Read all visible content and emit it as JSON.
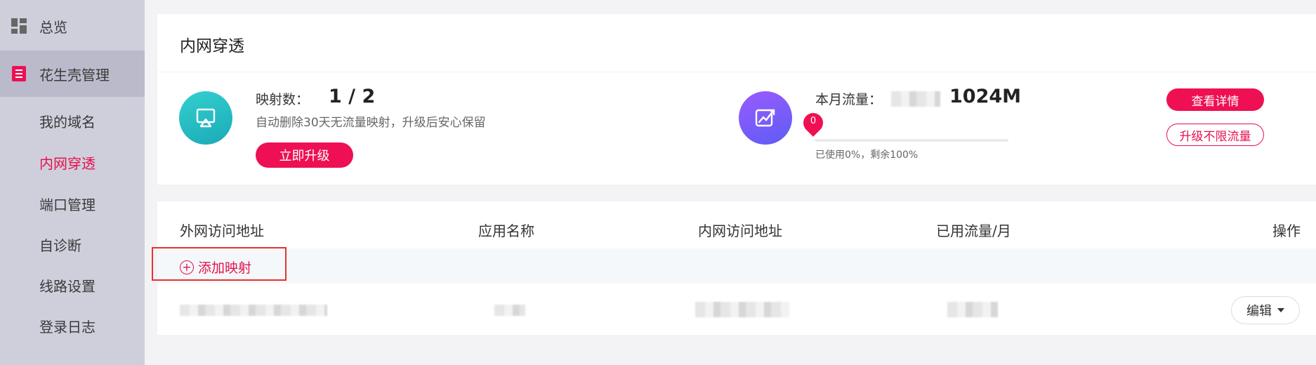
{
  "sidebar": {
    "items": [
      {
        "label": "总览"
      },
      {
        "label": "花生壳管理"
      }
    ],
    "sub_items": [
      {
        "label": "我的域名"
      },
      {
        "label": "内网穿透"
      },
      {
        "label": "端口管理"
      },
      {
        "label": "自诊断"
      },
      {
        "label": "线路设置"
      },
      {
        "label": "登录日志"
      }
    ]
  },
  "summary": {
    "title": "内网穿透",
    "mapping_label": "映射数：",
    "mapping_value": "1 / 2",
    "mapping_note": "自动删除30天无流量映射，升级后安心保留",
    "upgrade_now": "立即升级",
    "traffic_label": "本月流量：",
    "traffic_value": "1024M",
    "used_pin": "0",
    "used_fraction": 0,
    "usage_text": "已使用0%，剩余100%",
    "view_details": "查看详情",
    "upgrade_unlimited": "升级不限流量"
  },
  "table": {
    "columns": [
      "外网访问地址",
      "应用名称",
      "内网访问地址",
      "已用流量/月",
      "操作"
    ],
    "add_mapping": "添加映射",
    "edit": "编辑"
  },
  "colors": {
    "accent": "#ee1052",
    "sidebar_bg": "#cfcfdc"
  }
}
